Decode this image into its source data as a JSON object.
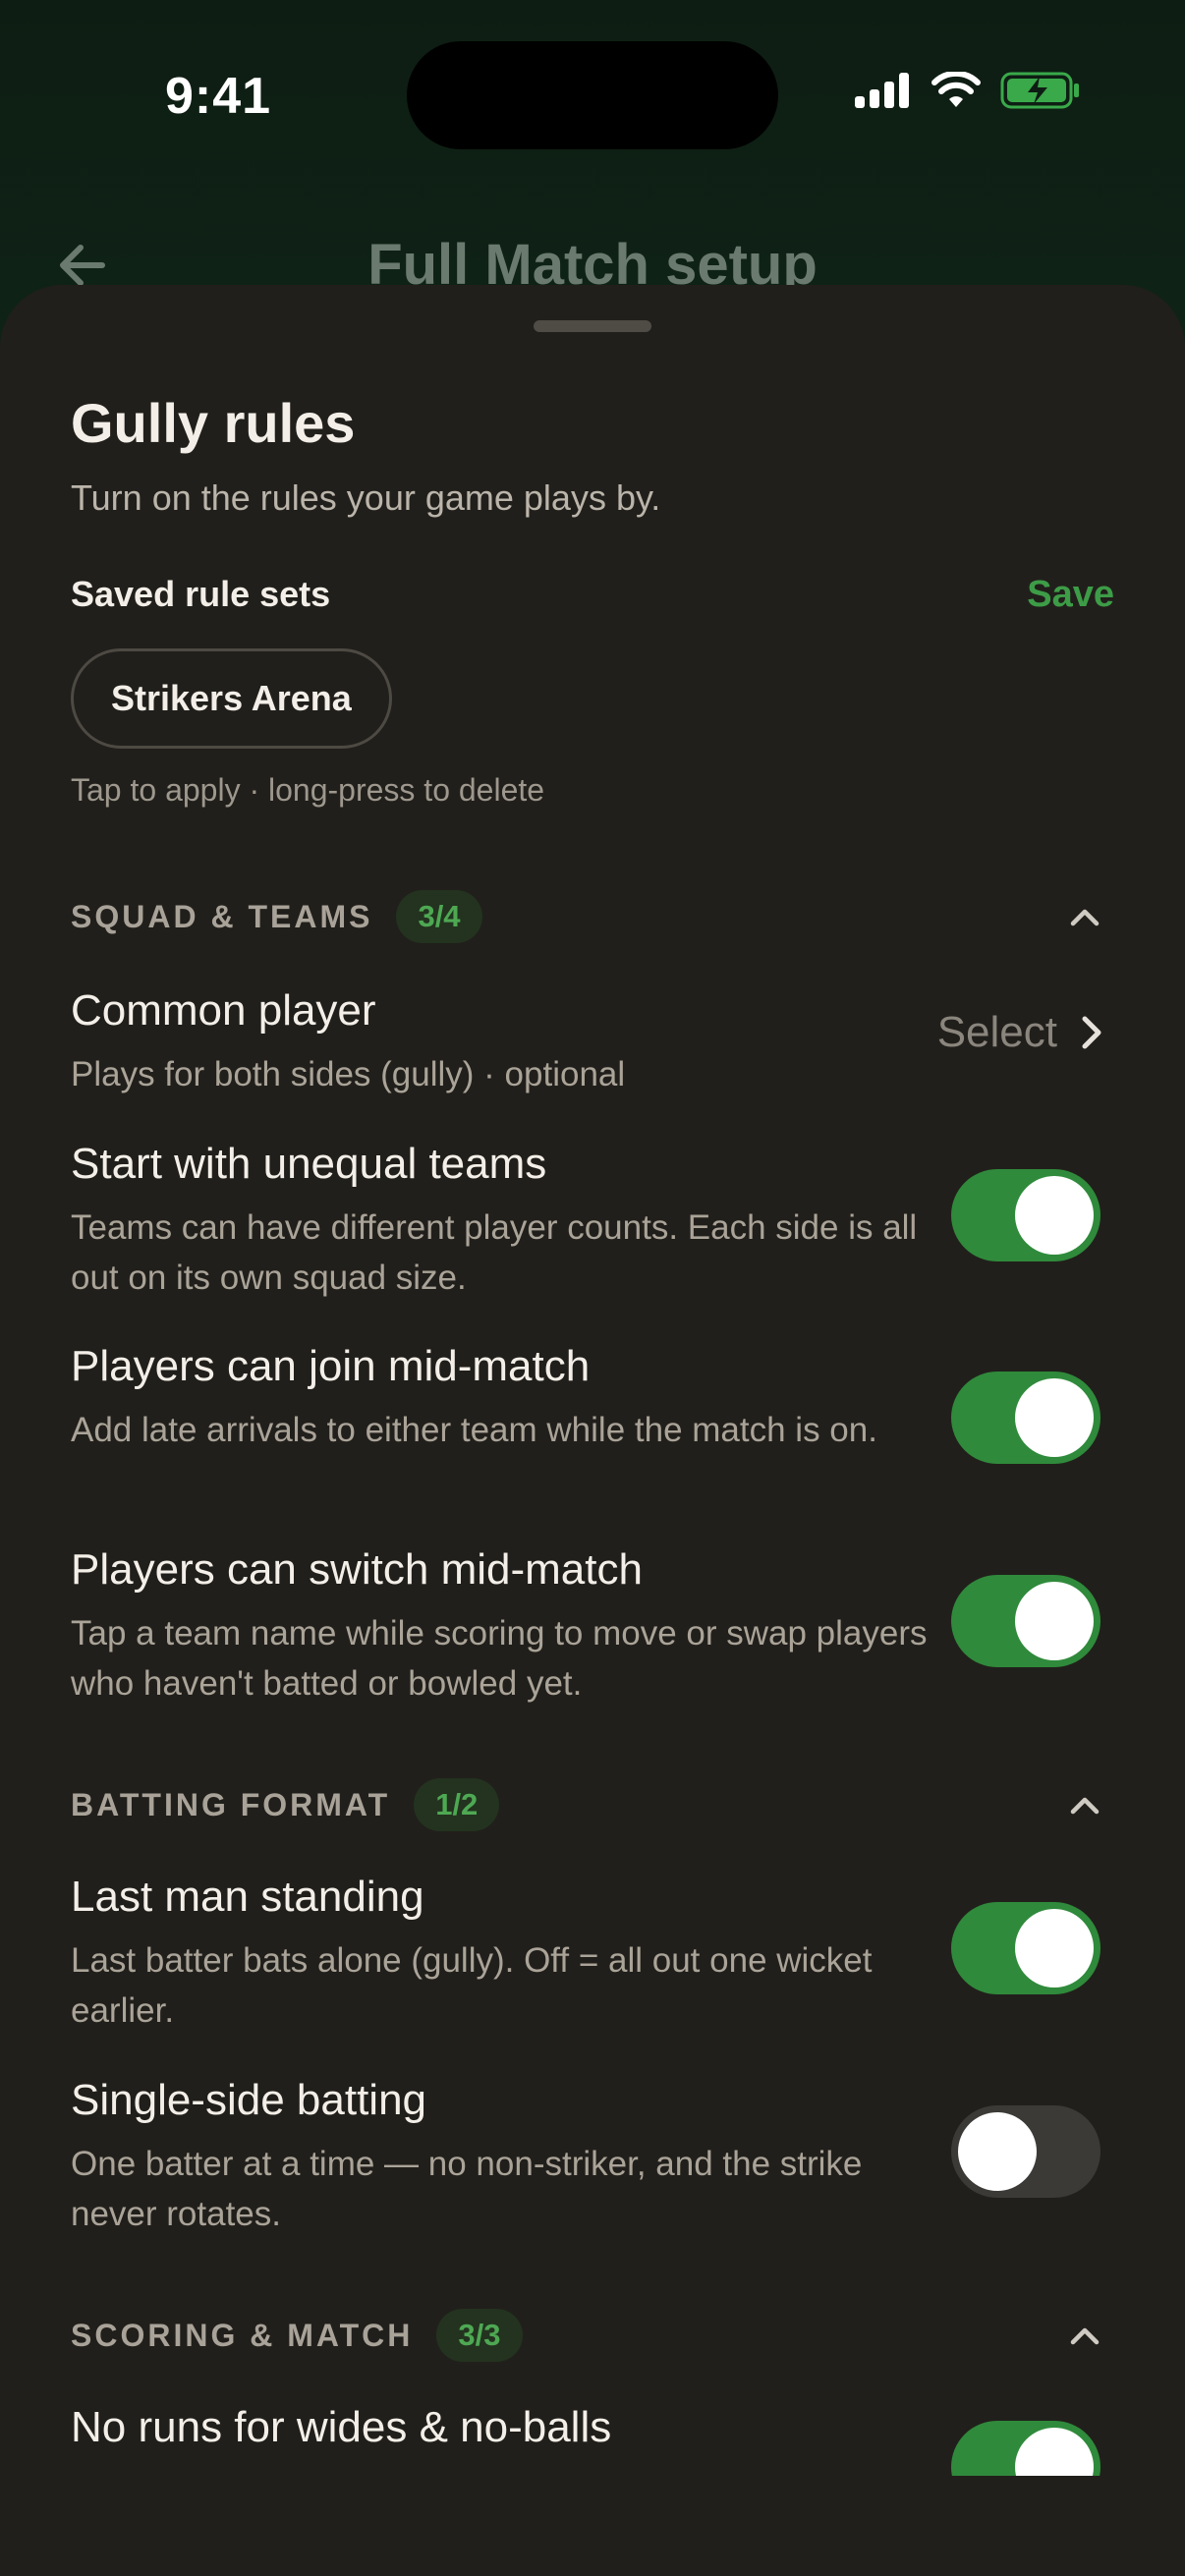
{
  "status": {
    "time": "9:41"
  },
  "header": {
    "title": "Full Match setup"
  },
  "sheet": {
    "title": "Gully rules",
    "subtitle": "Turn on the rules your game plays by.",
    "saved_label": "Saved rule sets",
    "save_label": "Save",
    "chips": [
      "Strikers Arena"
    ],
    "hint": "Tap to apply · long-press to delete"
  },
  "sections": [
    {
      "title": "SQUAD & TEAMS",
      "count": "3/4",
      "rows": [
        {
          "title": "Common player",
          "desc": "Plays for both sides (gully) · optional",
          "control": "select",
          "value": "Select"
        },
        {
          "title": "Start with unequal teams",
          "desc": "Teams can have different player counts. Each side is all out on its own squad size.",
          "control": "toggle",
          "on": true
        },
        {
          "title": "Players can join mid-match",
          "desc": "Add late arrivals to either team while the match is on.",
          "control": "toggle",
          "on": true
        },
        {
          "title": "Players can switch mid-match",
          "desc": "Tap a team name while scoring to move or swap players who haven't batted or bowled yet.",
          "control": "toggle",
          "on": true
        }
      ]
    },
    {
      "title": "BATTING FORMAT",
      "count": "1/2",
      "rows": [
        {
          "title": "Last man standing",
          "desc": "Last batter bats alone (gully). Off = all out one wicket earlier.",
          "control": "toggle",
          "on": true
        },
        {
          "title": "Single-side batting",
          "desc": "One batter at a time — no non-striker, and the strike never rotates.",
          "control": "toggle",
          "on": false
        }
      ]
    },
    {
      "title": "SCORING & MATCH",
      "count": "3/3",
      "rows": [
        {
          "title": "No runs for wides & no-balls",
          "desc": "",
          "control": "toggle",
          "on": true
        }
      ]
    }
  ],
  "colors": {
    "accent": "#2f8a3b",
    "sheet_bg": "#211f1b",
    "badge_text": "#4ea853"
  },
  "icons": {
    "back": "arrow-left-icon",
    "caret": "chevron-up-icon",
    "select": "chevron-right-icon"
  }
}
